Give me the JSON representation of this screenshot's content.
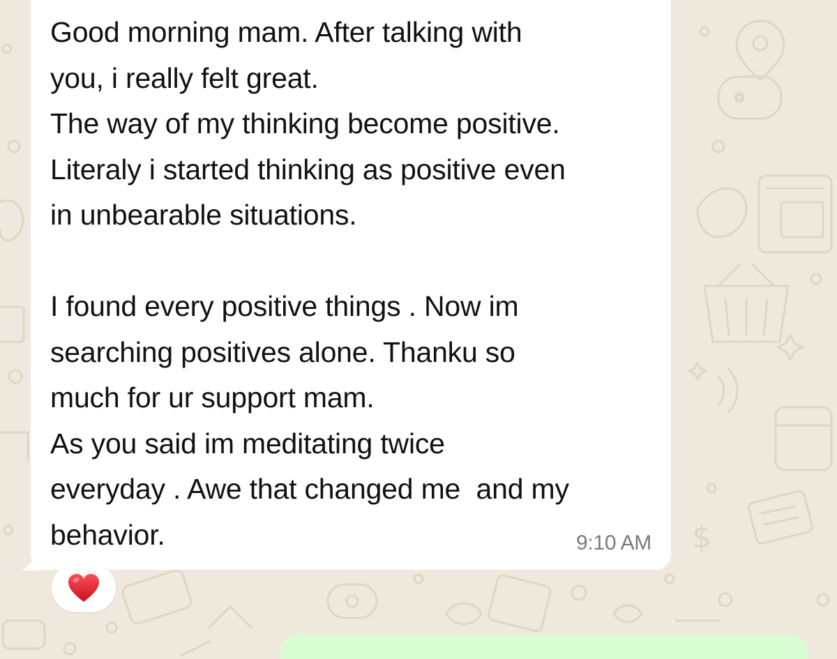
{
  "chat": {
    "incoming_message": {
      "text": "Good morning mam. After talking with\nyou, i really felt great.\nThe way of my thinking become positive.\nLiteraly i started thinking as positive even\nin unbearable situations.\n\nI found every positive things . Now im\nsearching positives alone. Thanku so\nmuch for ur support mam.\nAs you said im meditating twice\neveryday . Awe that changed me  and my\nbehavior.",
      "time": "9:10 AM",
      "reaction_icon": "red-heart-icon"
    },
    "outgoing_message": {
      "bubble_color": "#d9fdd3"
    }
  },
  "colors": {
    "wallpaper": "#efe9dd",
    "doodle": "#ddd5c5",
    "incoming_bubble": "#ffffff",
    "heart": "#e0262f"
  }
}
